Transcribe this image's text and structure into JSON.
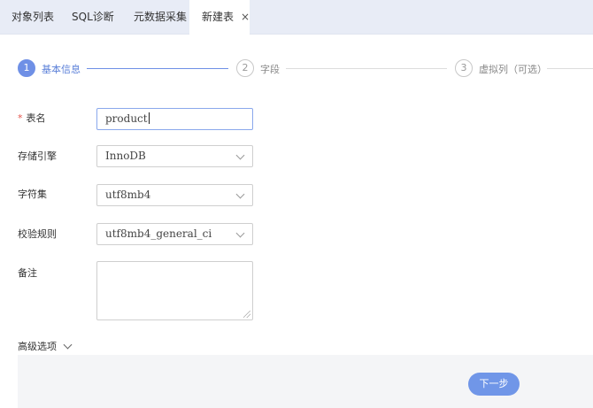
{
  "tabs": [
    {
      "label": "对象列表"
    },
    {
      "label": "SQL诊断"
    },
    {
      "label": "元数据采集"
    },
    {
      "label": "新建表",
      "close": "×"
    }
  ],
  "steps": [
    {
      "number": "1",
      "label": "基本信息",
      "state": "active"
    },
    {
      "number": "2",
      "label": "字段",
      "state": "inactive"
    },
    {
      "number": "3",
      "label": "虚拟列（可选）",
      "state": "inactive"
    }
  ],
  "form": {
    "table_name": {
      "required_mark": "*",
      "label": "表名",
      "value": "product"
    },
    "engine": {
      "label": "存储引擎",
      "value": "InnoDB"
    },
    "charset": {
      "label": "字符集",
      "value": "utf8mb4"
    },
    "collation": {
      "label": "校验规则",
      "value": "utf8mb4_general_ci"
    },
    "comment": {
      "label": "备注",
      "value": ""
    }
  },
  "advanced": {
    "label": "高级选项"
  },
  "footer": {
    "next_label": "下一步"
  },
  "colors": {
    "accent": "#6f90e6",
    "required": "#e5534b",
    "tabbar": "#e8ecf6"
  }
}
